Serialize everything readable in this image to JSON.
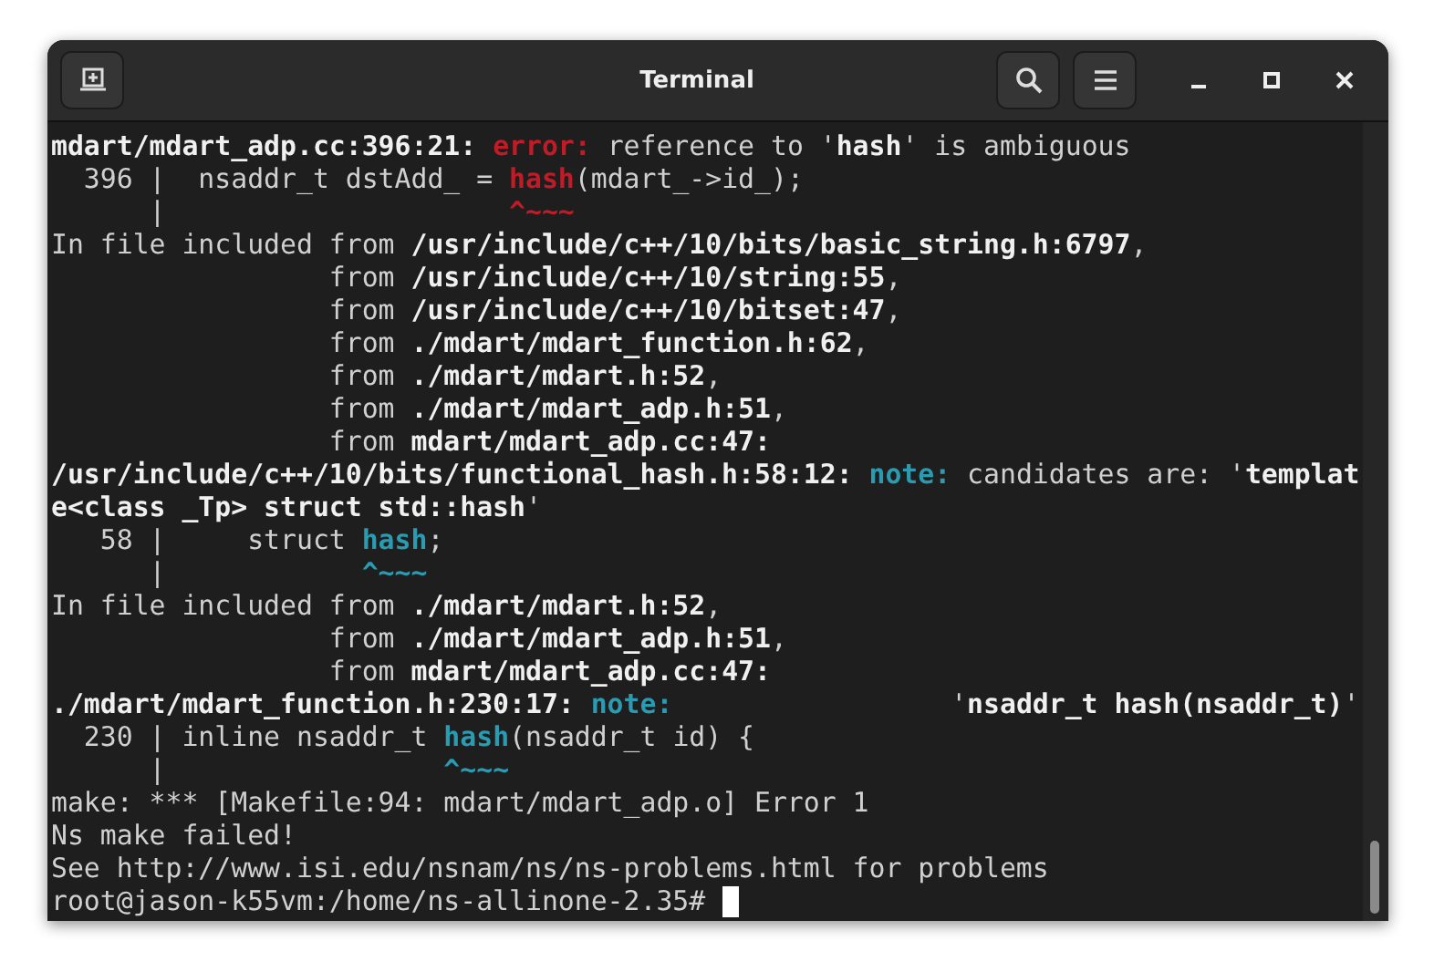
{
  "window": {
    "title": "Terminal"
  },
  "terminal": {
    "lines": [
      [
        {
          "text": "mdart/mdart_adp.cc:396:21: ",
          "kind": "bold"
        },
        {
          "text": "error:",
          "kind": "error"
        },
        {
          "text": " reference to '",
          "kind": "plain"
        },
        {
          "text": "hash",
          "kind": "bold"
        },
        {
          "text": "' is ambiguous",
          "kind": "plain"
        }
      ],
      [
        {
          "text": "  396 |  nsaddr_t dstAdd_ = ",
          "kind": "plain"
        },
        {
          "text": "hash",
          "kind": "error"
        },
        {
          "text": "(mdart_->id_);",
          "kind": "plain"
        }
      ],
      [
        {
          "text": "      |                     ",
          "kind": "plain"
        },
        {
          "text": "^~~~",
          "kind": "error"
        }
      ],
      [
        {
          "text": "In file included from ",
          "kind": "plain"
        },
        {
          "text": "/usr/include/c++/10/bits/basic_string.h:6797",
          "kind": "bold"
        },
        {
          "text": ",",
          "kind": "plain"
        }
      ],
      [
        {
          "text": "                 from ",
          "kind": "plain"
        },
        {
          "text": "/usr/include/c++/10/string:55",
          "kind": "bold"
        },
        {
          "text": ",",
          "kind": "plain"
        }
      ],
      [
        {
          "text": "                 from ",
          "kind": "plain"
        },
        {
          "text": "/usr/include/c++/10/bitset:47",
          "kind": "bold"
        },
        {
          "text": ",",
          "kind": "plain"
        }
      ],
      [
        {
          "text": "                 from ",
          "kind": "plain"
        },
        {
          "text": "./mdart/mdart_function.h:62",
          "kind": "bold"
        },
        {
          "text": ",",
          "kind": "plain"
        }
      ],
      [
        {
          "text": "                 from ",
          "kind": "plain"
        },
        {
          "text": "./mdart/mdart.h:52",
          "kind": "bold"
        },
        {
          "text": ",",
          "kind": "plain"
        }
      ],
      [
        {
          "text": "                 from ",
          "kind": "plain"
        },
        {
          "text": "./mdart/mdart_adp.h:51",
          "kind": "bold"
        },
        {
          "text": ",",
          "kind": "plain"
        }
      ],
      [
        {
          "text": "                 from ",
          "kind": "plain"
        },
        {
          "text": "mdart/mdart_adp.cc:47:",
          "kind": "bold"
        }
      ],
      [
        {
          "text": "/usr/include/c++/10/bits/functional_hash.h:58:12: ",
          "kind": "bold"
        },
        {
          "text": "note:",
          "kind": "note"
        },
        {
          "text": " candidates are: '",
          "kind": "plain"
        },
        {
          "text": "templat",
          "kind": "bold"
        }
      ],
      [
        {
          "text": "e<class _Tp> struct std::hash",
          "kind": "bold"
        },
        {
          "text": "'",
          "kind": "plain"
        }
      ],
      [
        {
          "text": "   58 |     struct ",
          "kind": "plain"
        },
        {
          "text": "hash",
          "kind": "note"
        },
        {
          "text": ";",
          "kind": "plain"
        }
      ],
      [
        {
          "text": "      |            ",
          "kind": "plain"
        },
        {
          "text": "^~~~",
          "kind": "note"
        }
      ],
      [
        {
          "text": "In file included from ",
          "kind": "plain"
        },
        {
          "text": "./mdart/mdart.h:52",
          "kind": "bold"
        },
        {
          "text": ",",
          "kind": "plain"
        }
      ],
      [
        {
          "text": "                 from ",
          "kind": "plain"
        },
        {
          "text": "./mdart/mdart_adp.h:51",
          "kind": "bold"
        },
        {
          "text": ",",
          "kind": "plain"
        }
      ],
      [
        {
          "text": "                 from ",
          "kind": "plain"
        },
        {
          "text": "mdart/mdart_adp.cc:47:",
          "kind": "bold"
        }
      ],
      [
        {
          "text": "./mdart/mdart_function.h:230:17: ",
          "kind": "bold"
        },
        {
          "text": "note:",
          "kind": "note"
        },
        {
          "text": "                 '",
          "kind": "plain"
        },
        {
          "text": "nsaddr_t hash(nsaddr_t)",
          "kind": "bold"
        },
        {
          "text": "'",
          "kind": "plain"
        }
      ],
      [
        {
          "text": "  230 | inline nsaddr_t ",
          "kind": "plain"
        },
        {
          "text": "hash",
          "kind": "note"
        },
        {
          "text": "(nsaddr_t id) {",
          "kind": "plain"
        }
      ],
      [
        {
          "text": "      |                 ",
          "kind": "plain"
        },
        {
          "text": "^~~~",
          "kind": "note"
        }
      ],
      [
        {
          "text": "make: *** [Makefile:94: mdart/mdart_adp.o] Error 1",
          "kind": "plain"
        }
      ],
      [
        {
          "text": "Ns make failed!",
          "kind": "plain"
        }
      ],
      [
        {
          "text": "See http://www.isi.edu/nsnam/ns/ns-problems.html for problems",
          "kind": "plain"
        }
      ],
      [
        {
          "text": "root@jason-k55vm:/home/ns-allinone-2.35# ",
          "kind": "plain"
        }
      ]
    ]
  }
}
